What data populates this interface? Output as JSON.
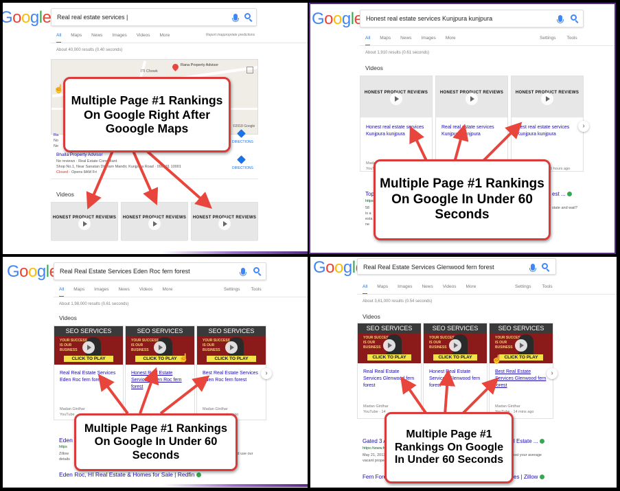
{
  "panels": [
    {
      "query": "Real real estate services |",
      "tabs": [
        "All",
        "Maps",
        "News",
        "Images",
        "Videos",
        "More"
      ],
      "report": "Report inappropriate predictions",
      "results": "About 40,000 results (0.40 seconds)",
      "videos_heading": "Videos",
      "map_place": "Rana Property Advisor",
      "map_landmark": "ITI Chowk",
      "map_copyright": "©2018 Google",
      "listing_name": "Bhalla Property Advisor",
      "listing_type": "No reviews · Real Estate Consultant",
      "listing_addr": "Shop No.1, Near Sanatan Dharam Mandir, Kunjpura Road · 098131 10001",
      "listing_closed": "Closed",
      "listing_opens": "· Opens 8AM Fri",
      "directions": "DIRECTIONS",
      "callout": "Multiple Page #1 Rankings On Google Right After Gooogle Maps",
      "thumb_text": "HONEST PRODUCT REVIEWS"
    },
    {
      "query": "Honest real estate services Kunjpura kunjpura",
      "tabs": [
        "All",
        "Maps",
        "News",
        "Images",
        "More"
      ],
      "right_tabs": [
        "Settings",
        "Tools"
      ],
      "results": "About 1,910 results (0.61 seconds)",
      "videos_heading": "Videos",
      "video_titles": [
        "Honest real estate services Kunjpura kunjpura",
        "Real real estate services Kunjpura kunjpura",
        "Best real estate services Kunjpura kunjpura"
      ],
      "meta_left": "Madan",
      "meta_left2": "YouTube",
      "meta_right": "5 hours ago",
      "below_link": "Top",
      "below_link_right": "est ...",
      "below_green": "https",
      "below_snip_right": "state and wait?",
      "callout": "Multiple Page #1 Rankings On Google In Under 60 Seconds",
      "thumb_text": "HONEST PRODUCT REVIEWS"
    },
    {
      "query": "Real Real Estate Services Eden Roc fern forest",
      "tabs": [
        "All",
        "Maps",
        "Images",
        "News",
        "Videos",
        "More"
      ],
      "right_tabs": [
        "Settings",
        "Tools"
      ],
      "results": "About 1,98,000 results (0.61 seconds)",
      "videos_heading": "Videos",
      "video_titles": [
        "Real Real Estate Services Eden Roc fern forest",
        "Honest Real Estate Services Eden Roc fern forest",
        "Best Real Estate Services Eden Roc fern forest"
      ],
      "meta_a": "Madan Girdhar",
      "meta_b": "YouTube",
      "meta_c": "Madan Girdhar",
      "meta_d": "mins ago",
      "result1": "Eden",
      "result1_green": "https",
      "result1_snip": "Zillow",
      "result1_snip2": "details",
      "result1_right": "y, and use our",
      "result2": "Eden Roc, HI Real Estate & Homes for Sale | Redfin",
      "callout": "Multiple Page #1 Rankings On Google In Under 60 Seconds",
      "seo_title": "SEO SERVICES",
      "seo_sub": "YOUR SUCCESS IS OUR BUSINESS",
      "seo_click": "CLICK TO PLAY"
    },
    {
      "query": "Real Real Estate Services Glenwood fern forest",
      "tabs": [
        "All",
        "Maps",
        "Images",
        "News",
        "Videos",
        "More"
      ],
      "right_tabs": [
        "Settings",
        "Tools"
      ],
      "results": "About 3,61,000 results (0.54 seconds)",
      "videos_heading": "Videos",
      "video_titles": [
        "Real Real Estate Services Glenwood fern forest",
        "Honest Real Estate Services Glenwood fern forest",
        "Best Real Estate Services Glenwood fern forest"
      ],
      "meta_a": "Madan Girdhar",
      "meta_b": "YouTube · 14",
      "meta_c": "Madan Girdhar",
      "meta_d": "YouTube · 14 mins ago",
      "result1": "Gated 3 A",
      "result1_right": "l Estate ...",
      "result1_green": "https://www.h",
      "result1_date": "May 21, 2013",
      "result1_snip": "vacant prope",
      "result1_snip_right": "ost your average",
      "result2": "Fern Fore",
      "result2_right": "es | Zillow",
      "callout": "Multiple Page #1 Rankings On Google In Under 60 Seconds",
      "seo_title": "SEO SERVICES",
      "seo_sub": "YOUR SUCCESS IS OUR BUSINESS",
      "seo_click": "CLICK TO PLAY"
    }
  ],
  "logo": "Google",
  "colors": {
    "callout_border": "#d93a3a",
    "arrow": "#e8453c",
    "link": "#1a0dab",
    "accent": "#1a73e8",
    "frame": "#5b2c83"
  }
}
